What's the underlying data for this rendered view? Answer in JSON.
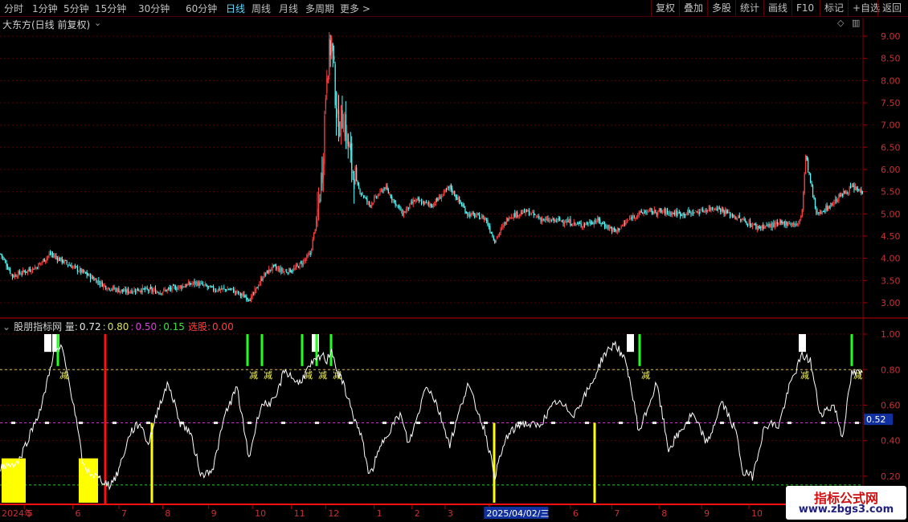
{
  "toolbar": {
    "periods": [
      "分时",
      "1分钟",
      "5分钟",
      "15分钟",
      "30分钟",
      "60分钟",
      "日线",
      "周线",
      "月线",
      "多周期",
      "更多 >"
    ],
    "active_period": "日线",
    "actions": [
      "复权",
      "叠加",
      "多股",
      "统计",
      "画线",
      "F10",
      "标记",
      "+自选",
      "返回"
    ]
  },
  "main_title": "大东方(日线 前复权)",
  "indicator": {
    "name": "股朋指标网 量:",
    "v1": "0.72",
    "sep1": ":",
    "v2": "0.80",
    "sep2": ":",
    "v3": "0.50",
    "sep3": ":",
    "v4": "0.15",
    "select_label": "选股:",
    "select_value": "0.00",
    "current_value_tag": "0.52",
    "signal_char": "减"
  },
  "watermark": {
    "title": "指标公式网",
    "url": "www.zbgs3.com"
  },
  "x_axis": {
    "year_label": "2024年",
    "months": [
      {
        "label": "5",
        "day": 20
      },
      {
        "label": "6",
        "day": 61
      },
      {
        "label": "7",
        "day": 100
      },
      {
        "label": "8",
        "day": 137
      },
      {
        "label": "9",
        "day": 176
      },
      {
        "label": "10",
        "day": 213
      },
      {
        "label": "11",
        "day": 246
      },
      {
        "label": "12",
        "day": 275
      },
      {
        "label": "1",
        "day": 316
      },
      {
        "label": "2",
        "day": 348
      },
      {
        "label": "3",
        "day": 376
      },
      {
        "label": "4",
        "day": 413
      },
      {
        "label": "6",
        "day": 482
      },
      {
        "label": "7",
        "day": 517
      },
      {
        "label": "8",
        "day": 557
      },
      {
        "label": "9",
        "day": 593
      },
      {
        "label": "10",
        "day": 633
      }
    ],
    "highlight_date": "2025/04/02/三",
    "highlight_day": 413
  },
  "chart_data": [
    {
      "type": "candlestick",
      "title": "大东方(日线 前复权)",
      "ylim": [
        2.8,
        9.2
      ],
      "yticks": [
        "3.00",
        "3.50",
        "4.00",
        "4.50",
        "5.00",
        "5.50",
        "6.00",
        "6.50",
        "7.00",
        "7.50",
        "8.00",
        "8.50",
        "9.00"
      ],
      "ytick_values": [
        3.0,
        3.5,
        4.0,
        4.5,
        5.0,
        5.5,
        6.0,
        6.5,
        7.0,
        7.5,
        8.0,
        8.5,
        9.0
      ],
      "up_color": "#ff4040",
      "down_color": "#54fcfc",
      "keypoints_day": [
        0,
        10,
        30,
        42,
        55,
        75,
        90,
        105,
        118,
        135,
        150,
        165,
        180,
        195,
        205,
        212,
        222,
        230,
        240,
        248,
        255,
        262,
        268,
        272,
        276,
        280,
        285,
        290,
        296,
        302,
        312,
        325,
        340,
        350,
        365,
        380,
        395,
        410,
        418,
        430,
        445,
        460,
        475,
        490,
        505,
        520,
        535,
        545,
        560,
        575,
        590,
        605,
        620,
        640,
        655,
        665,
        675,
        678,
        681,
        690,
        700,
        710,
        720,
        728
      ],
      "keypoints_close": [
        4.1,
        3.6,
        3.8,
        4.1,
        3.9,
        3.6,
        3.35,
        3.25,
        3.3,
        3.25,
        3.35,
        3.45,
        3.3,
        3.3,
        3.15,
        3.1,
        3.6,
        3.8,
        3.7,
        3.75,
        3.9,
        4.1,
        5.0,
        6.0,
        8.3,
        8.9,
        7.0,
        7.2,
        6.2,
        5.6,
        5.2,
        5.6,
        5.0,
        5.3,
        5.2,
        5.6,
        5.0,
        4.9,
        4.4,
        4.95,
        5.05,
        4.85,
        4.85,
        4.75,
        4.85,
        4.6,
        4.95,
        5.05,
        5.05,
        5.0,
        5.05,
        5.15,
        4.95,
        4.7,
        4.75,
        4.8,
        4.75,
        5.1,
        6.3,
        5.0,
        5.15,
        5.4,
        5.6,
        5.5
      ]
    },
    {
      "type": "line",
      "name": "股朋指标网",
      "ylim": [
        0.05,
        1.05
      ],
      "yticks": [
        "0.20",
        "0.40",
        "0.60",
        "0.80",
        "1.00"
      ],
      "ytick_values": [
        0.2,
        0.4,
        0.6,
        0.8,
        1.0
      ],
      "hlines": [
        {
          "value": 0.8,
          "color": "#c8c864"
        },
        {
          "value": 0.5,
          "color": "#c832c8"
        },
        {
          "value": 0.15,
          "color": "#32c832"
        }
      ],
      "keypoints_day": [
        0,
        15,
        35,
        45,
        52,
        62,
        70,
        80,
        92,
        98,
        103,
        110,
        118,
        125,
        135,
        142,
        152,
        160,
        170,
        180,
        190,
        200,
        210,
        220,
        232,
        240,
        252,
        262,
        272,
        276,
        280,
        285,
        290,
        298,
        306,
        312,
        325,
        338,
        345,
        352,
        360,
        368,
        380,
        395,
        410,
        418,
        428,
        440,
        455,
        470,
        485,
        500,
        510,
        520,
        530,
        540,
        555,
        565,
        575,
        585,
        598,
        610,
        622,
        628,
        636,
        645,
        650,
        658,
        668,
        678,
        685,
        693,
        705,
        712,
        720,
        728
      ],
      "keypoints_value": [
        0.25,
        0.28,
        0.6,
        0.9,
        0.92,
        0.6,
        0.25,
        0.2,
        0.15,
        0.2,
        0.3,
        0.45,
        0.5,
        0.38,
        0.62,
        0.72,
        0.5,
        0.45,
        0.2,
        0.25,
        0.55,
        0.7,
        0.3,
        0.6,
        0.62,
        0.8,
        0.72,
        0.82,
        0.88,
        0.85,
        0.92,
        0.78,
        0.72,
        0.55,
        0.4,
        0.2,
        0.42,
        0.55,
        0.38,
        0.52,
        0.72,
        0.62,
        0.38,
        0.72,
        0.45,
        0.2,
        0.42,
        0.5,
        0.48,
        0.62,
        0.55,
        0.72,
        0.88,
        0.95,
        0.82,
        0.45,
        0.72,
        0.35,
        0.45,
        0.55,
        0.38,
        0.62,
        0.45,
        0.22,
        0.2,
        0.45,
        0.5,
        0.48,
        0.72,
        0.88,
        0.85,
        0.55,
        0.6,
        0.42,
        0.78,
        0.78
      ],
      "green_bars_day": [
        72,
        308,
        326,
        376,
        394,
        412,
        796,
        1060
      ],
      "white_bars_day": [
        55,
        65,
        388,
        780,
        994
      ],
      "signal_days": [
        72,
        308,
        326,
        376,
        394,
        412,
        796,
        994,
        1060
      ],
      "red_bar_day": 131,
      "yellow_blocks": [
        [
          2,
          32
        ],
        [
          98,
          122
        ]
      ],
      "yellow_bars_day": [
        189,
        615,
        740
      ]
    }
  ]
}
